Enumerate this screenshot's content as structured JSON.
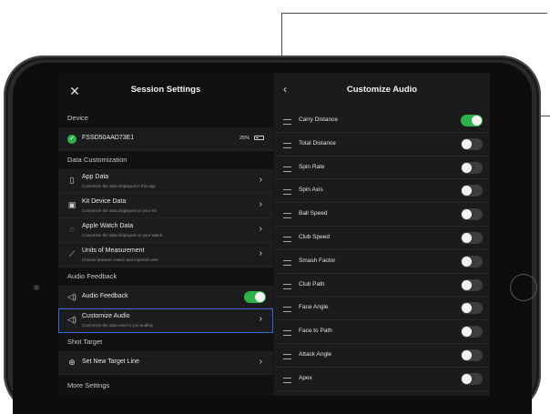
{
  "left_pane": {
    "title": "Session Settings",
    "close_icon": "close-icon",
    "device_section": "Device",
    "device": {
      "name": "FSSD50AAD73E1",
      "battery": "25%"
    },
    "data_section": "Data Customization",
    "data_items": [
      {
        "label": "App Data",
        "sub": "Customize the data displayed in this app",
        "icon": "phone-icon"
      },
      {
        "label": "Kit Device Data",
        "sub": "Customize the data displayed on your Kit",
        "icon": "kit-device-icon"
      },
      {
        "label": "Apple Watch Data",
        "sub": "Customize the data displayed on your watch",
        "icon": "watch-icon"
      },
      {
        "label": "Units of Measurement",
        "sub": "Choose between metric and imperial units",
        "icon": "ruler-icon"
      }
    ],
    "audio_section": "Audio Feedback",
    "audio_feedback": {
      "label": "Audio Feedback",
      "on": true
    },
    "customize_audio": {
      "label": "Customize Audio",
      "sub": "Customize the data read to you audibly"
    },
    "shot_section": "Shot Target",
    "target": {
      "label": "Set New Target Line"
    },
    "more_section": "More Settings"
  },
  "right_pane": {
    "title": "Customize Audio",
    "options": [
      {
        "label": "Carry Distance",
        "on": true
      },
      {
        "label": "Total Distance",
        "on": false
      },
      {
        "label": "Spin Rate",
        "on": false
      },
      {
        "label": "Spin Axis",
        "on": false
      },
      {
        "label": "Ball Speed",
        "on": false
      },
      {
        "label": "Club Speed",
        "on": false
      },
      {
        "label": "Smash Factor",
        "on": false
      },
      {
        "label": "Club Path",
        "on": false
      },
      {
        "label": "Face Angle",
        "on": false
      },
      {
        "label": "Face to Path",
        "on": false
      },
      {
        "label": "Attack Angle",
        "on": false
      },
      {
        "label": "Apex",
        "on": false
      }
    ]
  },
  "colors": {
    "toggle_on": "#2fb24b",
    "selection_outline": "#3a66d6"
  }
}
